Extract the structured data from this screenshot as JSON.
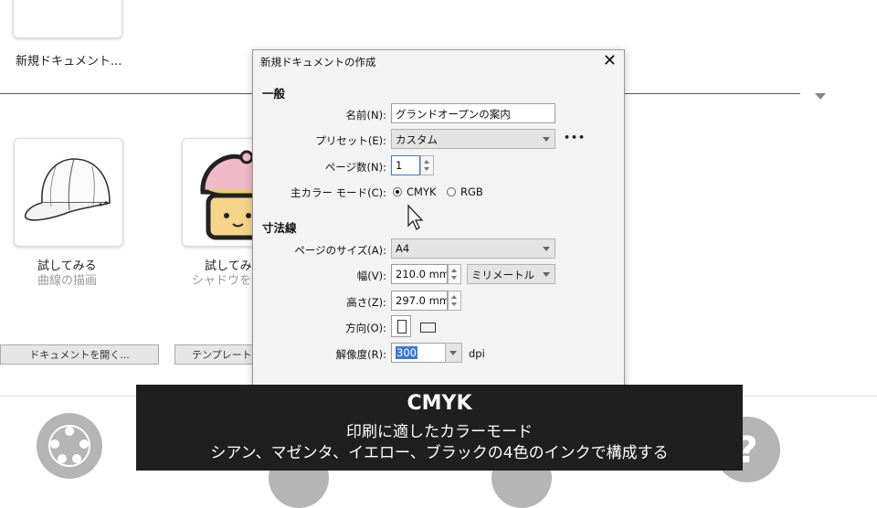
{
  "welcome": {
    "new_document_label": "新規ドキュメント...",
    "templates": [
      {
        "title": "試してみる",
        "subtitle": "曲線の描画"
      },
      {
        "title": "試してみ",
        "subtitle": "シャドウを"
      }
    ],
    "open_document_button": "ドキュメントを開く...",
    "template_button": "テンプレートか"
  },
  "dialog": {
    "title": "新規ドキュメントの作成",
    "general_header": "一般",
    "name_label": "名前(N):",
    "name_value": "グランドオープンの案内",
    "preset_label": "プリセット(E):",
    "preset_value": "カスタム",
    "more_label": "•••",
    "pages_label": "ページ数(N):",
    "pages_value": "1",
    "color_mode_label": "主カラー モード(C):",
    "color_mode_options": [
      "CMYK",
      "RGB"
    ],
    "color_mode_selected": "CMYK",
    "dimensions_header": "寸法線",
    "page_size_label": "ページのサイズ(A):",
    "page_size_value": "A4",
    "width_label": "幅(V):",
    "width_value": "210.0 mm",
    "unit_value": "ミリメートル",
    "height_label": "高さ(Z):",
    "height_value": "297.0 mm",
    "orientation_label": "方向(O):",
    "resolution_label": "解像度(R):",
    "resolution_value": "300",
    "resolution_unit": "dpi"
  },
  "caption": {
    "title": "CMYK",
    "line1": "印刷に適したカラーモード",
    "line2": "シアン、マゼンタ、イエロー、ブラックの4色のインクで構成する"
  },
  "colors": {
    "caption_bg": "#1f1f1f",
    "selection": "#3a78d6",
    "icon_gray": "#b5b5b5"
  }
}
